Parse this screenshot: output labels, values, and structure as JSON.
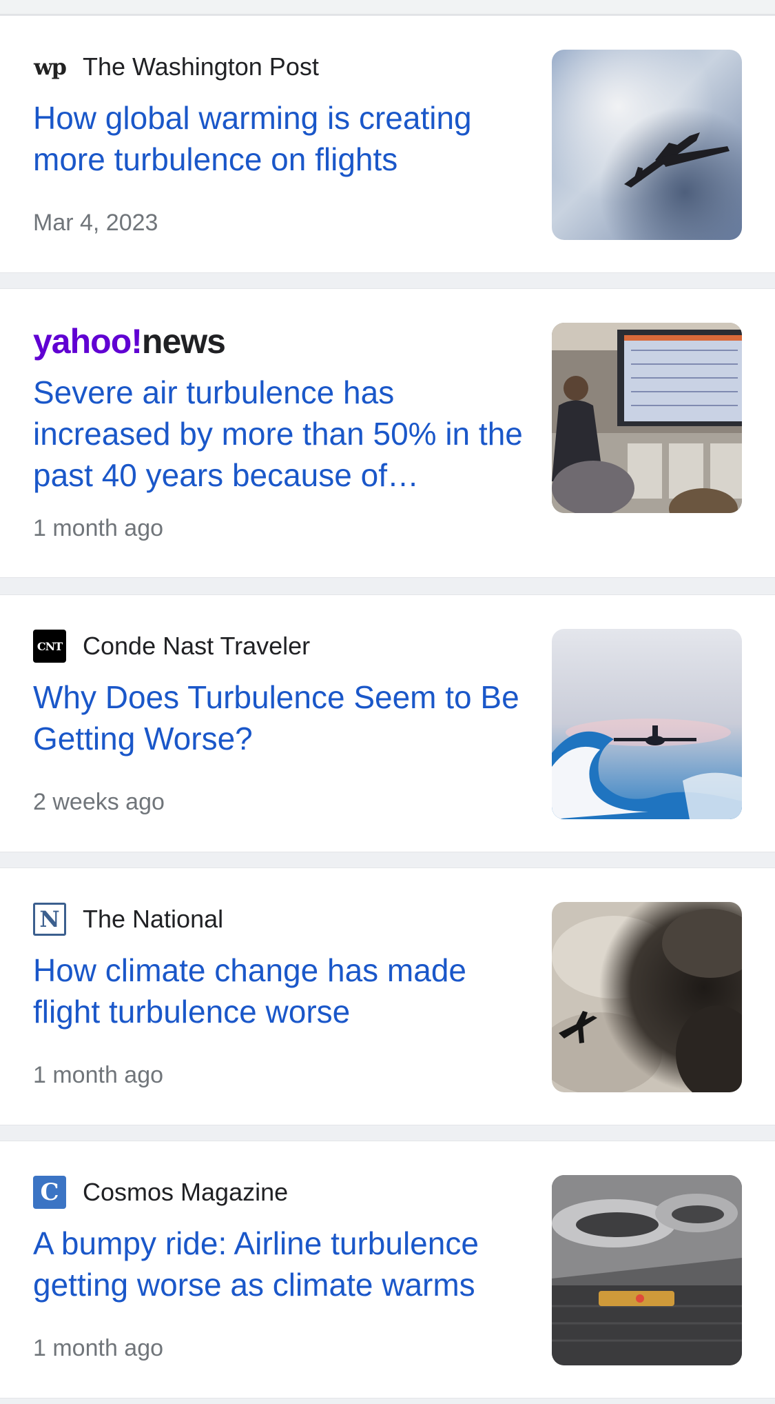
{
  "articles": [
    {
      "source": "The Washington Post",
      "logo_icon": "wp-logo-icon",
      "logo_text": "wp",
      "headline": "How global warming is creating more turbulence on flights",
      "date": "Mar 4, 2023",
      "thumbnail": "airplane-in-clouds-image"
    },
    {
      "source": "yahoo!news",
      "logo_part1": "yahoo!",
      "logo_part2": "news",
      "headline": "Severe air turbulence has increased by more than 50% in the past 40 years because of…",
      "date": "1 month ago",
      "thumbnail": "flight-attendant-cabin-image"
    },
    {
      "source": "Conde Nast Traveler",
      "logo_icon": "cnt-logo-icon",
      "logo_text": "CNT",
      "headline": "Why Does Turbulence Seem to Be Getting Worse?",
      "date": "2 weeks ago",
      "thumbnail": "airplane-over-wave-image"
    },
    {
      "source": "The National",
      "logo_icon": "the-national-logo-icon",
      "logo_text": "N",
      "headline": "How climate change has made flight turbulence worse",
      "date": "1 month ago",
      "thumbnail": "airplane-dark-clouds-image"
    },
    {
      "source": "Cosmos Magazine",
      "logo_icon": "cosmos-logo-icon",
      "logo_text": "C",
      "headline": "A bumpy ride: Airline turbulence getting worse as climate warms",
      "date": "1 month ago",
      "thumbnail": "cabin-seatbelt-sign-image"
    }
  ],
  "colors": {
    "headline": "#1a57c9",
    "source": "#202124",
    "date": "#70757a",
    "background": "#eef0f3",
    "card": "#ffffff",
    "yahoo_purple": "#6001d2"
  }
}
